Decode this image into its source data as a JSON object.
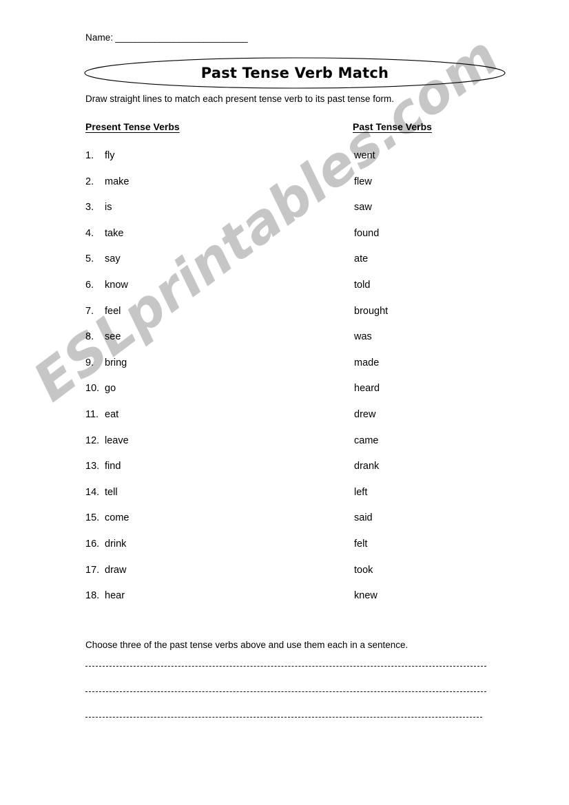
{
  "worksheet": {
    "name_label": "Name:",
    "name_blank": "___________________________",
    "title": "Past Tense Verb Match",
    "instruction": "Draw straight lines to match each present tense verb to its past tense form.",
    "columns": {
      "left_header": "Present Tense Verbs",
      "right_header": "Past Tense Verbs"
    },
    "present_tense_verbs": [
      {
        "num": "1.",
        "word": "fly"
      },
      {
        "num": "2.",
        "word": "make"
      },
      {
        "num": "3.",
        "word": "is"
      },
      {
        "num": "4.",
        "word": "take"
      },
      {
        "num": "5.",
        "word": "say"
      },
      {
        "num": "6.",
        "word": "know"
      },
      {
        "num": "7.",
        "word": "feel"
      },
      {
        "num": "8.",
        "word": "see"
      },
      {
        "num": "9.",
        "word": "bring"
      },
      {
        "num": "10.",
        "word": "go"
      },
      {
        "num": "11.",
        "word": "eat"
      },
      {
        "num": "12.",
        "word": "leave"
      },
      {
        "num": "13.",
        "word": "find"
      },
      {
        "num": "14.",
        "word": "tell"
      },
      {
        "num": "15.",
        "word": "come"
      },
      {
        "num": "16.",
        "word": "drink"
      },
      {
        "num": "17.",
        "word": "draw"
      },
      {
        "num": "18.",
        "word": "hear"
      }
    ],
    "past_tense_verbs": [
      {
        "word": "went"
      },
      {
        "word": "flew"
      },
      {
        "word": "saw"
      },
      {
        "word": "found"
      },
      {
        "word": "ate"
      },
      {
        "word": "told"
      },
      {
        "word": "brought"
      },
      {
        "word": "was"
      },
      {
        "word": "made"
      },
      {
        "word": "heard"
      },
      {
        "word": "drew"
      },
      {
        "word": "came"
      },
      {
        "word": "drank"
      },
      {
        "word": "left"
      },
      {
        "word": "said"
      },
      {
        "word": "felt"
      },
      {
        "word": "took"
      },
      {
        "word": "knew"
      }
    ],
    "bottom_prompt": "Choose three of the past tense verbs above and use them each in a sentence.",
    "answer_lines": [
      "",
      "",
      ""
    ],
    "watermark": "ESLprintables.com",
    "colors": {
      "text": "#000000",
      "watermark": "#c6c6c6",
      "page_background": "#ffffff",
      "rule": "#111111"
    }
  }
}
